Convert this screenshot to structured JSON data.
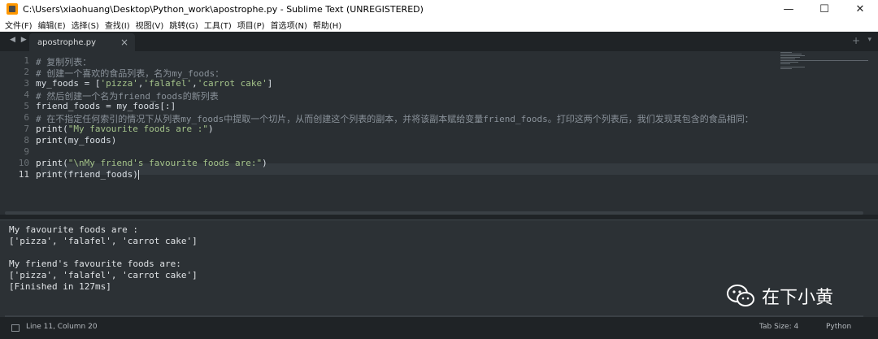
{
  "window": {
    "title": "C:\\Users\\xiaohuang\\Desktop\\Python_work\\apostrophe.py - Sublime Text (UNREGISTERED)",
    "minimize": "—",
    "maximize": "☐",
    "close": "✕"
  },
  "menu": [
    "文件(F)",
    "编辑(E)",
    "选择(S)",
    "查找(I)",
    "视图(V)",
    "跳转(G)",
    "工具(T)",
    "项目(P)",
    "首选项(N)",
    "帮助(H)"
  ],
  "tabbar": {
    "arrows": "◀ ▶",
    "tab_label": "apostrophe.py",
    "tab_close": "×",
    "plus": "+",
    "chevron": "▾"
  },
  "editor": {
    "line_numbers": [
      "1",
      "2",
      "3",
      "4",
      "5",
      "6",
      "7",
      "8",
      "9",
      "10",
      "11"
    ],
    "active_line": 11,
    "lines": [
      [
        {
          "t": "# 复制列表：",
          "c": "cm"
        }
      ],
      [
        {
          "t": "# 创建一个喜欢的食品列表，名为my_foods：",
          "c": "cm"
        }
      ],
      [
        {
          "t": "my_foods = [",
          "c": ""
        },
        {
          "t": "'pizza'",
          "c": "str"
        },
        {
          "t": ",",
          "c": ""
        },
        {
          "t": "'falafel'",
          "c": "str"
        },
        {
          "t": ",",
          "c": ""
        },
        {
          "t": "'carrot cake'",
          "c": "str"
        },
        {
          "t": "]",
          "c": ""
        }
      ],
      [
        {
          "t": "# 然后创建一个名为friend_foods的新列表",
          "c": "cm"
        }
      ],
      [
        {
          "t": "friend_foods = my_foods[:]",
          "c": ""
        }
      ],
      [
        {
          "t": "# 在不指定任何索引的情况下从列表my_foods中提取一个切片，从而创建这个列表的副本，并将该副本赋给变量friend_foods。打印这两个列表后，我们发现其包含的食品相同：",
          "c": "cm"
        }
      ],
      [
        {
          "t": "print",
          "c": "fn"
        },
        {
          "t": "(",
          "c": ""
        },
        {
          "t": "\"My favourite foods are :\"",
          "c": "str"
        },
        {
          "t": ")",
          "c": ""
        }
      ],
      [
        {
          "t": "print",
          "c": "fn"
        },
        {
          "t": "(my_foods)",
          "c": ""
        }
      ],
      [],
      [
        {
          "t": "print",
          "c": "fn"
        },
        {
          "t": "(",
          "c": ""
        },
        {
          "t": "\"\\nMy friend's favourite foods are:\"",
          "c": "str"
        },
        {
          "t": ")",
          "c": ""
        }
      ],
      [
        {
          "t": "print",
          "c": "fn"
        },
        {
          "t": "(friend_foods)",
          "c": ""
        }
      ]
    ]
  },
  "output": {
    "lines": [
      "My favourite foods are :",
      "['pizza', 'falafel', 'carrot cake']",
      "",
      "My friend's favourite foods are:",
      "['pizza', 'falafel', 'carrot cake']",
      "[Finished in 127ms]"
    ]
  },
  "watermark": {
    "text": "在下小黄",
    "icon": "wechat-icon"
  },
  "status": {
    "position": "Line 11, Column 20",
    "tab_size": "Tab Size: 4",
    "syntax": "Python"
  }
}
